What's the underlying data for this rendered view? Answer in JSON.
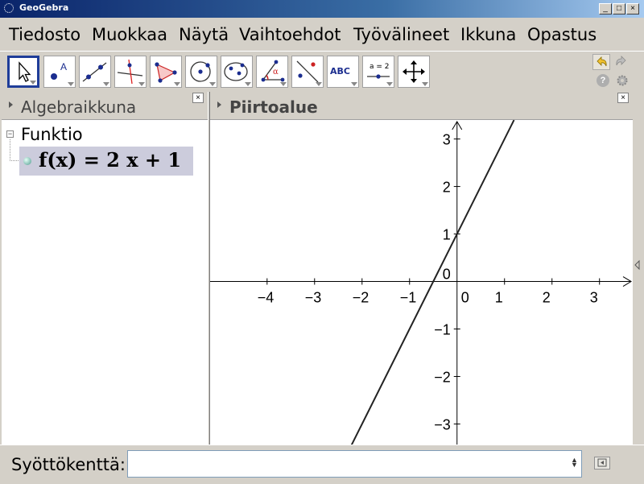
{
  "window": {
    "title": "GeoGebra",
    "minimize": "_",
    "maximize": "□",
    "close": "×"
  },
  "menu": [
    "Tiedosto",
    "Muokkaa",
    "Näytä",
    "Vaihtoehdot",
    "Työvälineet",
    "Ikkuna",
    "Opastus"
  ],
  "toolbar": {
    "tools": [
      "move-tool",
      "new-point-tool",
      "line-tool",
      "perpendicular-line-tool",
      "polygon-tool",
      "circle-tool",
      "conic-tool",
      "angle-tool",
      "reflect-tool",
      "text-tool",
      "slider-tool",
      "move-graphics-view-tool"
    ],
    "selected": "move-tool",
    "text_tool_label": "ABC",
    "slider_tool_label": "a = 2",
    "undo_icon": "undo-icon",
    "redo_icon": "redo-icon",
    "help_icon": "help-icon",
    "settings_icon": "gear-icon"
  },
  "algebra": {
    "title": "Algebraikkuna",
    "close": "×",
    "node": "Funktio",
    "function_text": "f(x) = 2 x + 1"
  },
  "graphics": {
    "title": "Piirtoalue",
    "close": "×"
  },
  "chart_data": {
    "type": "line",
    "title": "",
    "xlabel": "",
    "ylabel": "",
    "xlim": [
      -5.2,
      3.7
    ],
    "ylim": [
      -3.45,
      3.4
    ],
    "x_ticks": [
      -4,
      -3,
      -2,
      -1,
      0,
      1,
      2,
      3
    ],
    "y_ticks": [
      -3,
      -2,
      -1,
      1,
      2,
      3
    ],
    "x_tick_labels": [
      "−4",
      "−3",
      "−2",
      "−1",
      "0",
      "1",
      "2",
      "3"
    ],
    "y_tick_labels": [
      "−3",
      "−2",
      "−1",
      "1",
      "2",
      "3"
    ],
    "origin_label": "0",
    "grid": false,
    "series": [
      {
        "slope": 2,
        "intercept": 1,
        "x": [
          -2.25,
          1.2
        ],
        "y": [
          -3.5,
          3.4
        ],
        "color": "#222222"
      }
    ]
  },
  "input": {
    "label": "Syöttökenttä:",
    "value": "",
    "arrows": "▲▼"
  }
}
